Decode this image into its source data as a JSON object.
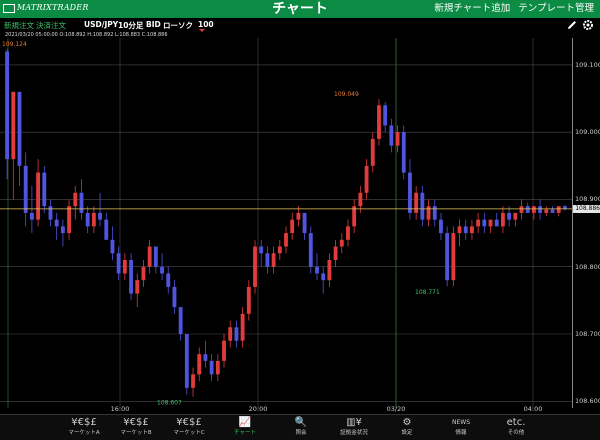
{
  "header": {
    "logo_text": "MATRIXTRADER",
    "title": "チャート",
    "new_chart": "新規チャート追加",
    "template": "テンプレート管理"
  },
  "toolbar": {
    "new_order": "新規注文",
    "settle_order": "決済注文",
    "symbol": "USD/JPY",
    "interval": "10分足",
    "side": "BID",
    "chart_type": "ローソク",
    "count": "100",
    "icons": [
      "pencil-icon",
      "gear-icon"
    ]
  },
  "ohlc_line": "2021/03/20 05:00:00  O:108.892  H:108.892  L:108.883  C:108.886",
  "price_axis": {
    "labels": [
      "109.100",
      "109.000",
      "108.900",
      "108.800",
      "108.700",
      "108.600"
    ],
    "current": "108.886"
  },
  "time_axis": {
    "labels": [
      "16:00",
      "20:00",
      "03/20",
      "04:00"
    ]
  },
  "annotations": {
    "high_left": "109.124",
    "high_mid": "109.049",
    "low_mid": "108.771",
    "low_left": "108.607"
  },
  "colors": {
    "up": "#e03c3c",
    "down": "#5055e0",
    "grid": "#4a4a4a",
    "current_line": "#e8c860",
    "brand": "#0b8b43",
    "high_label": "#e87a30",
    "low_label": "#3ec16a"
  },
  "candles": [
    [
      109.12,
      109.124,
      108.93,
      108.96
    ],
    [
      108.96,
      109.06,
      108.9,
      109.06
    ],
    [
      109.06,
      109.06,
      108.92,
      108.95
    ],
    [
      108.95,
      108.97,
      108.86,
      108.88
    ],
    [
      108.88,
      108.92,
      108.85,
      108.87
    ],
    [
      108.87,
      108.96,
      108.86,
      108.94
    ],
    [
      108.94,
      108.95,
      108.88,
      108.89
    ],
    [
      108.89,
      108.9,
      108.86,
      108.87
    ],
    [
      108.87,
      108.88,
      108.84,
      108.86
    ],
    [
      108.86,
      108.87,
      108.83,
      108.85
    ],
    [
      108.85,
      108.9,
      108.84,
      108.89
    ],
    [
      108.89,
      108.92,
      108.87,
      108.91
    ],
    [
      108.91,
      108.93,
      108.87,
      108.88
    ],
    [
      108.88,
      108.89,
      108.85,
      108.86
    ],
    [
      108.86,
      108.89,
      108.85,
      108.88
    ],
    [
      108.88,
      108.91,
      108.86,
      108.87
    ],
    [
      108.87,
      108.88,
      108.84,
      108.84
    ],
    [
      108.84,
      108.86,
      108.81,
      108.82
    ],
    [
      108.82,
      108.83,
      108.78,
      108.79
    ],
    [
      108.79,
      108.82,
      108.78,
      108.81
    ],
    [
      108.81,
      108.82,
      108.75,
      108.76
    ],
    [
      108.76,
      108.79,
      108.74,
      108.78
    ],
    [
      108.78,
      108.81,
      108.77,
      108.8
    ],
    [
      108.8,
      108.84,
      108.79,
      108.83
    ],
    [
      108.83,
      108.83,
      108.79,
      108.8
    ],
    [
      108.8,
      108.82,
      108.78,
      108.79
    ],
    [
      108.79,
      108.8,
      108.76,
      108.77
    ],
    [
      108.77,
      108.78,
      108.73,
      108.74
    ],
    [
      108.74,
      108.74,
      108.69,
      108.7
    ],
    [
      108.7,
      108.7,
      108.61,
      108.62
    ],
    [
      108.62,
      108.65,
      108.607,
      108.64
    ],
    [
      108.64,
      108.68,
      108.63,
      108.67
    ],
    [
      108.67,
      108.69,
      108.65,
      108.66
    ],
    [
      108.66,
      108.67,
      108.63,
      108.64
    ],
    [
      108.64,
      108.67,
      108.63,
      108.66
    ],
    [
      108.66,
      108.7,
      108.65,
      108.69
    ],
    [
      108.69,
      108.72,
      108.68,
      108.71
    ],
    [
      108.71,
      108.72,
      108.68,
      108.69
    ],
    [
      108.69,
      108.74,
      108.68,
      108.73
    ],
    [
      108.73,
      108.78,
      108.72,
      108.77
    ],
    [
      108.77,
      108.84,
      108.76,
      108.83
    ],
    [
      108.83,
      108.84,
      108.8,
      108.82
    ],
    [
      108.82,
      108.83,
      108.79,
      108.8
    ],
    [
      108.8,
      108.83,
      108.79,
      108.82
    ],
    [
      108.82,
      108.84,
      108.81,
      108.83
    ],
    [
      108.83,
      108.86,
      108.82,
      108.85
    ],
    [
      108.85,
      108.88,
      108.84,
      108.87
    ],
    [
      108.87,
      108.89,
      108.86,
      108.88
    ],
    [
      108.88,
      108.88,
      108.84,
      108.85
    ],
    [
      108.85,
      108.86,
      108.79,
      108.8
    ],
    [
      108.8,
      108.82,
      108.78,
      108.79
    ],
    [
      108.79,
      108.8,
      108.76,
      108.78
    ],
    [
      108.78,
      108.82,
      108.77,
      108.81
    ],
    [
      108.81,
      108.84,
      108.8,
      108.83
    ],
    [
      108.83,
      108.85,
      108.82,
      108.84
    ],
    [
      108.84,
      108.87,
      108.83,
      108.86
    ],
    [
      108.86,
      108.9,
      108.85,
      108.89
    ],
    [
      108.89,
      108.92,
      108.88,
      108.91
    ],
    [
      108.91,
      108.96,
      108.9,
      108.95
    ],
    [
      108.95,
      109.0,
      108.94,
      108.99
    ],
    [
      108.99,
      109.049,
      108.98,
      109.04
    ],
    [
      109.04,
      109.045,
      109.0,
      109.01
    ],
    [
      109.01,
      109.02,
      108.97,
      108.98
    ],
    [
      108.98,
      109.01,
      108.97,
      109.0
    ],
    [
      109.0,
      109.01,
      108.93,
      108.94
    ],
    [
      108.94,
      108.96,
      108.87,
      108.88
    ],
    [
      108.88,
      108.92,
      108.87,
      108.91
    ],
    [
      108.91,
      108.92,
      108.86,
      108.87
    ],
    [
      108.87,
      108.9,
      108.86,
      108.89
    ],
    [
      108.89,
      108.9,
      108.86,
      108.87
    ],
    [
      108.87,
      108.88,
      108.84,
      108.85
    ],
    [
      108.85,
      108.86,
      108.771,
      108.78
    ],
    [
      108.78,
      108.86,
      108.771,
      108.85
    ],
    [
      108.85,
      108.87,
      108.83,
      108.86
    ],
    [
      108.86,
      108.87,
      108.84,
      108.85
    ],
    [
      108.85,
      108.87,
      108.84,
      108.86
    ],
    [
      108.86,
      108.88,
      108.85,
      108.87
    ],
    [
      108.87,
      108.88,
      108.85,
      108.86
    ],
    [
      108.86,
      108.87,
      108.85,
      108.87
    ],
    [
      108.87,
      108.88,
      108.86,
      108.86
    ],
    [
      108.86,
      108.89,
      108.85,
      108.88
    ],
    [
      108.88,
      108.89,
      108.86,
      108.87
    ],
    [
      108.87,
      108.88,
      108.86,
      108.88
    ],
    [
      108.88,
      108.9,
      108.87,
      108.89
    ],
    [
      108.89,
      108.895,
      108.88,
      108.88
    ],
    [
      108.88,
      108.89,
      108.87,
      108.89
    ],
    [
      108.89,
      108.9,
      108.87,
      108.88
    ],
    [
      108.88,
      108.89,
      108.875,
      108.885
    ],
    [
      108.885,
      108.89,
      108.88,
      108.88
    ],
    [
      108.88,
      108.89,
      108.875,
      108.89
    ],
    [
      108.89,
      108.892,
      108.883,
      108.886
    ]
  ],
  "tabs": [
    {
      "icon": "¥€$£",
      "label": "マーケットA",
      "name": "tab-market-a"
    },
    {
      "icon": "¥€$£",
      "label": "マーケットB",
      "name": "tab-market-b"
    },
    {
      "icon": "¥€$£",
      "label": "マーケットC",
      "name": "tab-market-c"
    },
    {
      "icon": "📈",
      "label": "チャート",
      "name": "tab-chart",
      "active": true
    },
    {
      "icon": "🔍",
      "label": "照会",
      "name": "tab-inquiry"
    },
    {
      "icon": "▥¥",
      "label": "証拠金状況",
      "name": "tab-margin"
    },
    {
      "icon": "⚙",
      "label": "設定",
      "name": "tab-settings"
    },
    {
      "icon": "NEWS",
      "label": "情報",
      "name": "tab-news"
    },
    {
      "icon": "etc.",
      "label": "その他",
      "name": "tab-etc"
    }
  ]
}
